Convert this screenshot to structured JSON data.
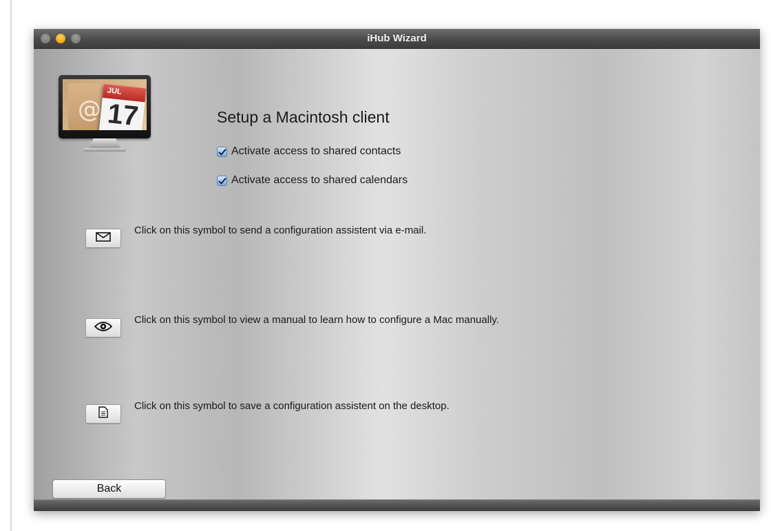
{
  "window": {
    "title": "iHub Wizard"
  },
  "illustration": {
    "calendar_month": "JUL",
    "calendar_day": "17",
    "contact_symbol": "@"
  },
  "setup": {
    "heading": "Setup a Macintosh client",
    "options": [
      {
        "label": "Activate access to shared contacts",
        "checked": true
      },
      {
        "label": "Activate access to shared calendars",
        "checked": true
      }
    ]
  },
  "actions": [
    {
      "icon": "envelope-icon",
      "text": "Click on this symbol to send a configuration assistent via e-mail."
    },
    {
      "icon": "eye-icon",
      "text": "Click on this symbol to view a manual to learn how to configure a Mac manually."
    },
    {
      "icon": "document-icon",
      "text": "Click on this symbol to save a configuration assistent on the desktop."
    }
  ],
  "footer": {
    "back_label": "Back"
  },
  "colors": {
    "checkbox_accent": "#7aa8dc",
    "minimize_button": "#f2a20b",
    "titlebar": "#4a4a4a"
  }
}
